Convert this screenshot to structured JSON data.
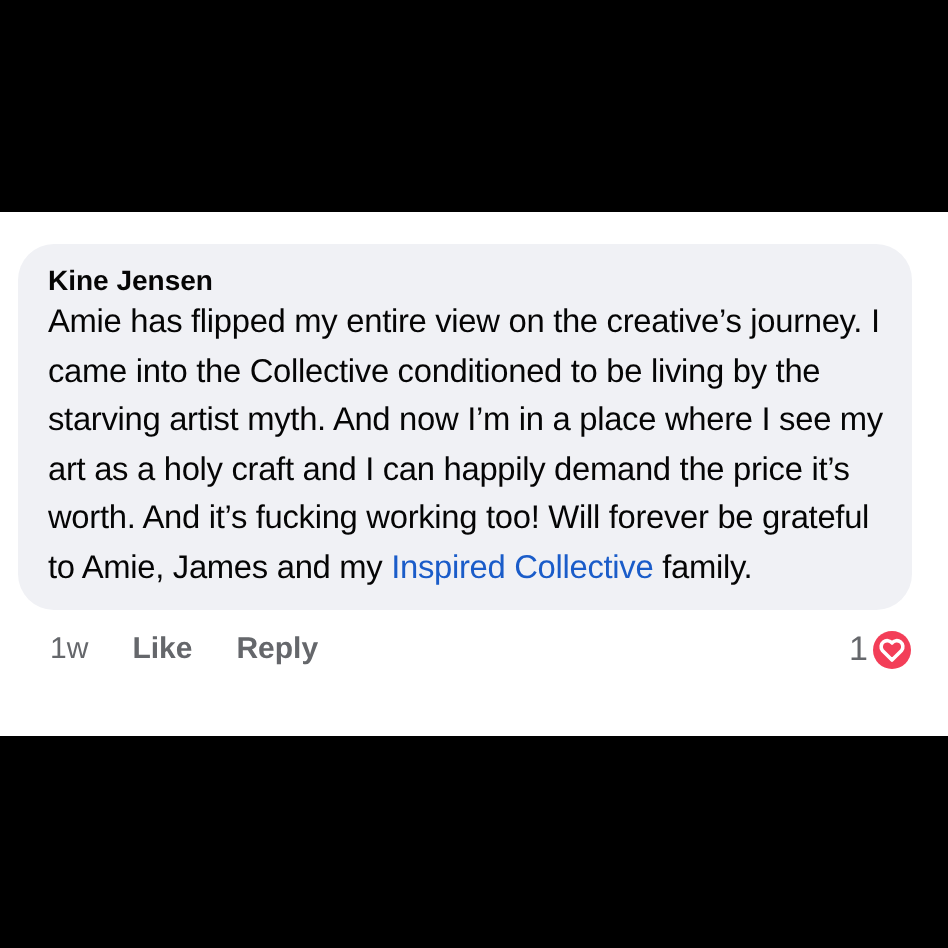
{
  "comment": {
    "author": "Kine Jensen",
    "text_before": "Amie has flipped my entire view on the creative’s journey. I came into the Collective conditioned to be living by the starving artist myth. And now I’m in a place where I see my art as a holy craft and I can happily demand the price it’s worth. And it’s fucking working too! Will forever be grateful to Amie, James and my",
    "link": "Inspired Collective",
    "text_after": "family.",
    "time": "1w",
    "actions": [
      "Like",
      "Reply"
    ],
    "reaction_count": "1"
  }
}
